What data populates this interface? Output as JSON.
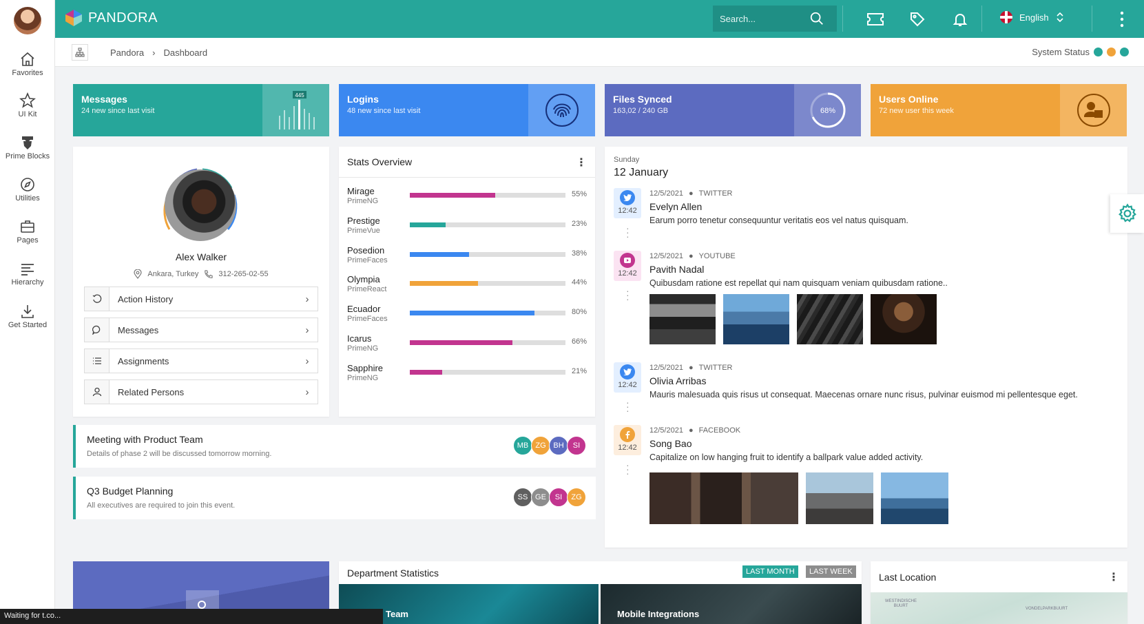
{
  "brand": {
    "name": "PANDORA"
  },
  "search": {
    "placeholder": "Search..."
  },
  "language": {
    "label": "English"
  },
  "sidebar": {
    "items": [
      {
        "label": "Favorites",
        "icon": "home-icon"
      },
      {
        "label": "UI Kit",
        "icon": "star-icon"
      },
      {
        "label": "Prime Blocks",
        "icon": "prime-icon"
      },
      {
        "label": "Utilities",
        "icon": "compass-icon"
      },
      {
        "label": "Pages",
        "icon": "briefcase-icon"
      },
      {
        "label": "Hierarchy",
        "icon": "align-left-icon"
      },
      {
        "label": "Get Started",
        "icon": "download-icon"
      }
    ]
  },
  "breadcrumb": {
    "items": [
      "Pandora",
      "Dashboard"
    ],
    "separator": "›"
  },
  "system_status": {
    "label": "System Status",
    "colors": [
      "#26a69a",
      "#f0a33a",
      "#26a69a"
    ]
  },
  "widgets": [
    {
      "title": "Messages",
      "subtitle": "24 new since last visit",
      "color": "#26a69a",
      "badge": "445"
    },
    {
      "title": "Logins",
      "subtitle": "48 new since last visit",
      "color": "#3b88f0"
    },
    {
      "title": "Files Synced",
      "subtitle": "163,02 / 240 GB",
      "color": "#5c6bc0",
      "progress": "68%"
    },
    {
      "title": "Users Online",
      "subtitle": "72 new user this week",
      "color": "#f0a33a"
    }
  ],
  "profile": {
    "name": "Alex Walker",
    "location": "Ankara, Turkey",
    "phone": "312-265-02-55",
    "links": [
      {
        "label": "Action History",
        "icon": "history-icon"
      },
      {
        "label": "Messages",
        "icon": "comment-icon"
      },
      {
        "label": "Assignments",
        "icon": "list-icon"
      },
      {
        "label": "Related Persons",
        "icon": "user-icon"
      }
    ]
  },
  "stats": {
    "title": "Stats Overview",
    "rows": [
      {
        "name": "Mirage",
        "sub": "PrimeNG",
        "value": 0.55,
        "pct": "55%",
        "color": "#c2358f"
      },
      {
        "name": "Prestige",
        "sub": "PrimeVue",
        "value": 0.23,
        "pct": "23%",
        "color": "#26a69a"
      },
      {
        "name": "Posedion",
        "sub": "PrimeFaces",
        "value": 0.38,
        "pct": "38%",
        "color": "#3b88f0"
      },
      {
        "name": "Olympia",
        "sub": "PrimeReact",
        "value": 0.44,
        "pct": "44%",
        "color": "#f0a33a"
      },
      {
        "name": "Ecuador",
        "sub": "PrimeFaces",
        "value": 0.8,
        "pct": "80%",
        "color": "#3b88f0"
      },
      {
        "name": "Icarus",
        "sub": "PrimeNG",
        "value": 0.66,
        "pct": "66%",
        "color": "#c2358f"
      },
      {
        "name": "Sapphire",
        "sub": "PrimeNG",
        "value": 0.21,
        "pct": "21%",
        "color": "#c2358f"
      }
    ]
  },
  "timeline": {
    "day": "Sunday",
    "date": "12 January",
    "items": [
      {
        "time": "12:42",
        "date": "12/5/2021",
        "source": "TWITTER",
        "name": "Evelyn Allen",
        "text": "Earum porro tenetur consequuntur veritatis eos vel natus quisquam.",
        "icon": "twitter-icon",
        "color": "#3b88f0",
        "bg": "#e3efff"
      },
      {
        "time": "12:42",
        "date": "12/5/2021",
        "source": "YOUTUBE",
        "name": "Pavith Nadal",
        "text": "Quibusdam ratione est repellat qui nam quisquam veniam quibusdam ratione..",
        "icon": "youtube-icon",
        "color": "#c2358f",
        "bg": "#fbe3f2"
      },
      {
        "time": "12:42",
        "date": "12/5/2021",
        "source": "TWITTER",
        "name": "Olivia Arribas",
        "text": "Mauris malesuada quis risus ut consequat. Maecenas ornare nunc risus, pulvinar euismod mi pellentesque eget.",
        "icon": "twitter-icon",
        "color": "#3b88f0",
        "bg": "#e3efff"
      },
      {
        "time": "12:42",
        "date": "12/5/2021",
        "source": "FACEBOOK",
        "name": "Song Bao",
        "text": "Capitalize on low hanging fruit to identify a ballpark value added activity.",
        "icon": "facebook-icon",
        "color": "#f0a33a",
        "bg": "#fdeede"
      }
    ]
  },
  "meetings": [
    {
      "title": "Meeting with Product Team",
      "subtitle": "Details of phase 2 will be discussed tomorrow morning.",
      "avatars": [
        {
          "initials": "MB",
          "color": "#26a69a"
        },
        {
          "initials": "ZG",
          "color": "#f0a33a"
        },
        {
          "initials": "BH",
          "color": "#5c6bc0"
        },
        {
          "initials": "SI",
          "color": "#c2358f"
        }
      ]
    },
    {
      "title": "Q3 Budget Planning",
      "subtitle": "All executives are required to join this event.",
      "avatars": [
        {
          "initials": "SS",
          "color": "#5f5f5f"
        },
        {
          "initials": "GE",
          "color": "#8d8d8d"
        },
        {
          "initials": "SI",
          "color": "#c2358f"
        },
        {
          "initials": "ZG",
          "color": "#f0a33a"
        }
      ]
    }
  ],
  "department": {
    "title": "Department Statistics",
    "tabs": [
      "LAST MONTH",
      "LAST WEEK"
    ],
    "cards": [
      "Team",
      "Mobile Integrations"
    ]
  },
  "last_location": {
    "title": "Last Location",
    "map_labels": [
      "WESTINDISCHE BUURT",
      "VONDELPARKBUURT"
    ]
  },
  "browser_status": "Waiting for t.co..."
}
